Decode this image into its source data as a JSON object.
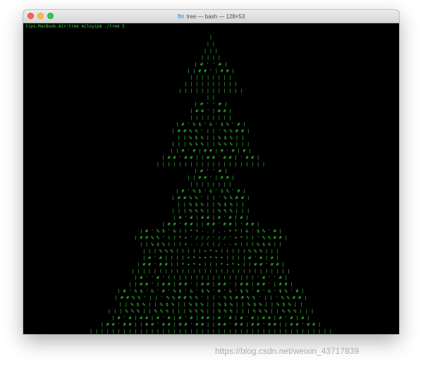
{
  "window": {
    "title": "tree — bash — 128×53",
    "folder_icon": "folder-icon"
  },
  "terminal": {
    "prompt": "tips-MacBook-Air:tree miloyip$ ./tree 5",
    "foreground": "#36d436",
    "background": "#000000",
    "tree_rows": [
      "|",
      "| |",
      "| | |",
      "| | | |",
      "| # ' ' #  |",
      "| | # # ' | # # |",
      "| | | | | | | |",
      "| | | | | | | | | |",
      "| | | | | | | | | | | |",
      "| |",
      "| # ' ' #  |",
      "| # # ' | # # |",
      "| | | | | | | |",
      "| # ' % $ ' & ' $ % ' # |",
      "| # # % % ' |  | ' % % # # |",
      "| | % $ % |  | % $ % | |",
      "| | | % % % |  | % % % | | |",
      "| | # ' # | # # | # ' # | # |",
      "| # # ' # # | | # # ' # # | ' # # |",
      "| | | | | | | | | | | | | | | | | | | |",
      "| # ' ' #  |",
      "| | # # ' | # # |",
      "| | | | | | | |",
      "| # ' % $ ' & ' $ % ' # |",
      "| # # % % ' |  | ' % % # # |",
      "| | % $ % |  | % $ % | |",
      "| | | % % % |  | % % % | | |",
      "| # ' # | # # | # ' # | # |",
      "| # # ' # # | | # # ' # # | ' # # |",
      "| # ' % $ ' & ) ( * + - . / . - + * ) & ' $ % ' # |",
      "| # # % % ' ) ) * + ' / / / ' / / ' + * ) ) ' % % # # |",
      "| | % $ % ( ) ( + - - / ( ( / - - + ( ) ( % $ % | |",
      "| | | % % % ( ) ( ) ( + * + ) ( ) ( ) % % % | | |",
      "| # ' # | ( ( ) + * + + * + + ) ) ( | # ' # | # |",
      "| # # ' # # ) ( * + * + ) ( ) * + * + ) ( # # ' # # |",
      "| | | | | ( | ) ( ) ( ) ( ) ( ) ( ) ( ) ( ) ( | ) | | | |",
      "| # ' ' # ' ( ( | ) ) ( ( | | ( ( ) ) | ( ( ' # ' ' # |",
      "| | # # ' | # # | # # ' | # # | # # ' | # # | # # ' | # # |",
      "| # ' % $ ' & ' # ' % $ ' & ' $ % ' # ' & ' $ % ' # ' & ' $ % ' # |",
      "| # # % % ' |  | ' % % # # % % ' | | ' % % # # % % ' |  | ' % % # # |",
      "| | % $ % |  | % $ % | | % $ % |  | % $ % | | % $ % |  | % $ % | |",
      "| | | % % % |  | % % % | | | % % % |  | % % % | | | % % % |  | % % % | | |",
      "| # ' # | # # | # ' # | # ' # | # # | # ' # | # ' # | # # | # ' # | # |",
      "| # # ' # # | | # # ' # # | # # ' # # | | # # ' # # | # # ' # # | | # # ' # # |",
      "| | | | | | | | | | | | | | | | | | | | | | | | | | | | | | | | | | | | | | | | | | | |"
    ]
  },
  "watermark": "https://blog.csdn.net/weixin_43717839"
}
